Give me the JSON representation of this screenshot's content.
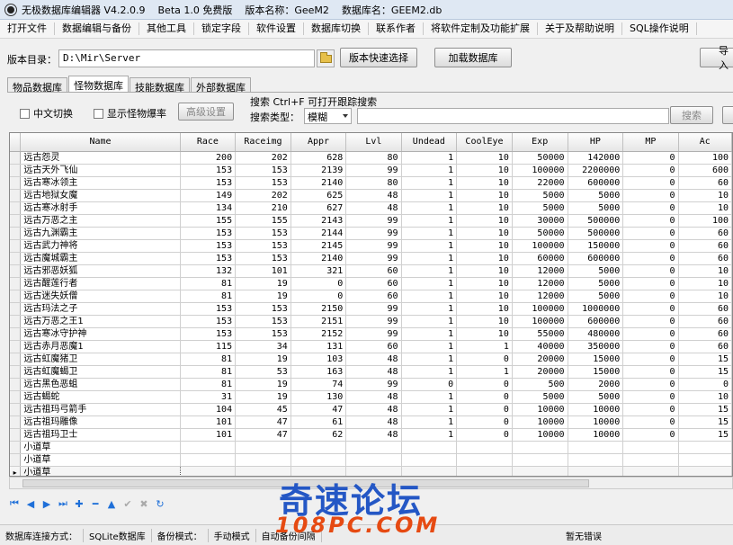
{
  "title": {
    "app_name": "无极数据库编辑器 V4.2.0.9",
    "edition": "Beta 1.0 免费版",
    "version_name": "版本名称：GeeM2",
    "db_name": "数据库名：GEEM2.db"
  },
  "menu": [
    "打开文件",
    "数据编辑与备份",
    "其他工具",
    "锁定字段",
    "软件设置",
    "数据库切换",
    "联系作者",
    "将软件定制及功能扩展",
    "关于及帮助说明",
    "SQL操作说明"
  ],
  "dir_row": {
    "label": "版本目录：",
    "path": "D:\\Mir\\Server",
    "quick_select_button": "版本快速选择",
    "load_button": "加载数据库",
    "import_button": "导入"
  },
  "tabs": [
    "物品数据库",
    "怪物数据库",
    "技能数据库",
    "外部数据库"
  ],
  "panel": {
    "chinese_switch": "中文切换",
    "show_monster_drops": "显示怪物爆率",
    "advanced_settings": "高级设置",
    "search_label": "搜索  Ctrl+F 可打开跟踪搜索",
    "search_type_label": "搜索类型：",
    "search_type_value": "模糊",
    "search_button": "搜索"
  },
  "table": {
    "columns": [
      "Name",
      "Race",
      "Raceimg",
      "Appr",
      "Lvl",
      "Undead",
      "CoolEye",
      "Exp",
      "HP",
      "MP",
      "Ac"
    ],
    "rows": [
      [
        "远古怨灵",
        "200",
        "202",
        "628",
        "80",
        "1",
        "10",
        "50000",
        "142000",
        "0",
        "100"
      ],
      [
        "远古天外飞仙",
        "153",
        "153",
        "2139",
        "99",
        "1",
        "10",
        "100000",
        "2200000",
        "0",
        "600"
      ],
      [
        "远古寒冰领主",
        "153",
        "153",
        "2140",
        "80",
        "1",
        "10",
        "22000",
        "600000",
        "0",
        "60"
      ],
      [
        "远古地狱女魔",
        "149",
        "202",
        "625",
        "48",
        "1",
        "10",
        "5000",
        "5000",
        "0",
        "10"
      ],
      [
        "远古寒冰射手",
        "134",
        "210",
        "627",
        "48",
        "1",
        "10",
        "5000",
        "5000",
        "0",
        "10"
      ],
      [
        "远古万恶之主",
        "155",
        "155",
        "2143",
        "99",
        "1",
        "10",
        "30000",
        "500000",
        "0",
        "100"
      ],
      [
        "远古九渊霸主",
        "153",
        "153",
        "2144",
        "99",
        "1",
        "10",
        "50000",
        "500000",
        "0",
        "60"
      ],
      [
        "远古武力神将",
        "153",
        "153",
        "2145",
        "99",
        "1",
        "10",
        "100000",
        "150000",
        "0",
        "60"
      ],
      [
        "远古魔城霸主",
        "153",
        "153",
        "2140",
        "99",
        "1",
        "10",
        "60000",
        "600000",
        "0",
        "60"
      ],
      [
        "远古邪恶妖狐",
        "132",
        "101",
        "321",
        "60",
        "1",
        "10",
        "12000",
        "5000",
        "0",
        "10"
      ],
      [
        "远古醒莲行者",
        "81",
        "19",
        "0",
        "60",
        "1",
        "10",
        "12000",
        "5000",
        "0",
        "10"
      ],
      [
        "远古迷失妖僧",
        "81",
        "19",
        "0",
        "60",
        "1",
        "10",
        "12000",
        "5000",
        "0",
        "10"
      ],
      [
        "远古玛法之子",
        "153",
        "153",
        "2150",
        "99",
        "1",
        "10",
        "100000",
        "1000000",
        "0",
        "60"
      ],
      [
        "远古万恶之王1",
        "153",
        "153",
        "2151",
        "99",
        "1",
        "10",
        "100000",
        "600000",
        "0",
        "60"
      ],
      [
        "远古寒冰守护神",
        "153",
        "153",
        "2152",
        "99",
        "1",
        "10",
        "55000",
        "480000",
        "0",
        "60"
      ],
      [
        "远古赤月恶魔1",
        "115",
        "34",
        "131",
        "60",
        "1",
        "1",
        "40000",
        "350000",
        "0",
        "60"
      ],
      [
        "远古虹魔猪卫",
        "81",
        "19",
        "103",
        "48",
        "1",
        "0",
        "20000",
        "15000",
        "0",
        "15"
      ],
      [
        "远古虹魔蝎卫",
        "81",
        "53",
        "163",
        "48",
        "1",
        "1",
        "20000",
        "15000",
        "0",
        "15"
      ],
      [
        "远古黑色恶蛆",
        "81",
        "19",
        "74",
        "99",
        "0",
        "0",
        "500",
        "2000",
        "0",
        "0"
      ],
      [
        "远古蝎蛇",
        "31",
        "19",
        "130",
        "48",
        "1",
        "0",
        "5000",
        "5000",
        "0",
        "10"
      ],
      [
        "远古祖玛弓箭手",
        "104",
        "45",
        "47",
        "48",
        "1",
        "0",
        "10000",
        "10000",
        "0",
        "15"
      ],
      [
        "远古祖玛雕像",
        "101",
        "47",
        "61",
        "48",
        "1",
        "0",
        "10000",
        "10000",
        "0",
        "15"
      ],
      [
        "远古祖玛卫士",
        "101",
        "47",
        "62",
        "48",
        "1",
        "0",
        "10000",
        "10000",
        "0",
        "15"
      ],
      [
        "小道草",
        "",
        "",
        "",
        "",
        "",
        "",
        "",
        "",
        "",
        ""
      ],
      [
        "小道草",
        "",
        "",
        "",
        "",
        "",
        "",
        "",
        "",
        "",
        ""
      ],
      [
        "小道草",
        "",
        "",
        "",
        "",
        "",
        "",
        "",
        "",
        "",
        ""
      ]
    ]
  },
  "nav_icons": [
    "first-icon",
    "prior-icon",
    "next-icon",
    "last-icon",
    "insert-icon",
    "delete-icon",
    "edit-icon",
    "post-icon",
    "cancel-icon",
    "refresh-icon"
  ],
  "status": {
    "conn_label": "数据库连接方式：",
    "conn_value": "SQLite数据库",
    "backup_label": "备份模式：",
    "backup_value": "手动模式",
    "extra": "自动备份间隔",
    "error": "暂无错误"
  },
  "watermark": {
    "line1": "奇速论坛",
    "line2": "108PC.COM"
  },
  "colors": {
    "accent": "#1e6fd8",
    "watermark_blue": "#2457c5",
    "watermark_orange": "#e64a12"
  }
}
